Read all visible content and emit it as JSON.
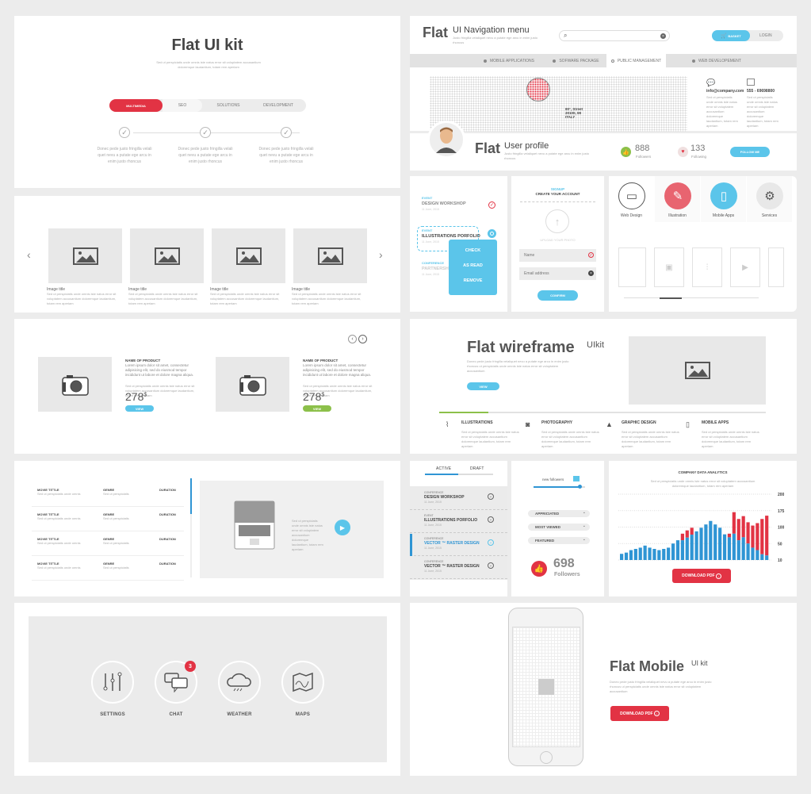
{
  "lorem": "Sed ut perspiciatis unde omnis iste natus error sit voluptatem accusantium doloremque laudantium, totam rem aperiam",
  "lorem_short": "Donec pede justo fringilla velit quet nevu a putate ege arcu in enim justo rhoncus",
  "colors": {
    "blue": "#5bc5ea",
    "red": "#e23344",
    "green": "#8cc04a",
    "gray": "#e8e8e8"
  },
  "kit": {
    "title": "Flat UI kit",
    "tabs": [
      {
        "label": "MULTIMEDIA",
        "active": true
      },
      {
        "label": "SEO"
      },
      {
        "label": "SOLUTIONS"
      },
      {
        "label": "DEVELOPMENT"
      }
    ],
    "steps": [
      "Donec pede justo fringilla velali quet nevu a putate ege arcu in enim justo rhoncus",
      "Donec pede justo fringilla velali quet nevu a putate ege arcu in enim justo rhoncus",
      "Donec pede justo fringilla velali quet nevu a putate ege arcu in enim justo rhoncus"
    ]
  },
  "gallery": {
    "items": [
      {
        "title": "Image title"
      },
      {
        "title": "Image title"
      },
      {
        "title": "Image title"
      },
      {
        "title": "Image title"
      }
    ]
  },
  "products": [
    {
      "name": "NAME OF PRODUCT",
      "desc": "Lorem ipsum dolor sit amet, consectetur adipisicing elit, sed do eiusmod tempor incididunt ut labore et dolore magna aliqua.",
      "price": "278",
      "currency": "$",
      "button": "VIEW",
      "color": "blue"
    },
    {
      "name": "NAME OF PRODUCT",
      "desc": "Lorem ipsum dolor sit amet, consectetur adipisicing elit, sed do eiusmod tempor incididunt ut labore et dolore magna aliqua.",
      "price": "278",
      "currency": "$",
      "button": "VIEW",
      "color": "green"
    }
  ],
  "movies": {
    "rows": [
      {
        "title": "MOVIE TITTLE",
        "genre": "GENRE",
        "duration": "DURATION"
      },
      {
        "title": "MOVIE TITTLE",
        "genre": "GENRE",
        "duration": "DURATION"
      },
      {
        "title": "MOVIE TITTLE",
        "genre": "GENRE",
        "duration": "DURATION"
      },
      {
        "title": "MOVIE TITTLE",
        "genre": "GENRE",
        "duration": "DURATION"
      }
    ]
  },
  "apps": [
    {
      "label": "SETTINGS",
      "icon": "sliders-icon"
    },
    {
      "label": "CHAT",
      "icon": "chat-icon",
      "badge": "3"
    },
    {
      "label": "WEATHER",
      "icon": "cloud-rain-icon"
    },
    {
      "label": "MAPS",
      "icon": "map-icon"
    }
  ],
  "nav": {
    "flat": "Flat",
    "title": "UI Navigation menu",
    "subtitle": "Justo fringilla velaliquet nevu a putate ege arcu in enim justo rhoncus",
    "basket": "BASKET",
    "login": "LOGIN",
    "menu": [
      {
        "label": "MOBILE APPLICATIONS"
      },
      {
        "label": "SOFWARE PACKAGE"
      },
      {
        "label": "PUBLIC MANAGEMENT",
        "active": true
      },
      {
        "label": "WEB DEVELOPEMENT"
      }
    ],
    "address": [
      "80°, Street",
      "20100, MI",
      "ITALY"
    ],
    "email": "info@company.com",
    "phone": "555 - 69698800"
  },
  "profile": {
    "flat": "Flat",
    "title": "User profile",
    "subtitle": "Justo fringilla velaliquet nevu a putate ege arcu in enim justo rhoncus",
    "followers": "888",
    "followers_label": "Followers",
    "following": "133",
    "following_label": "Following",
    "follow": "FOLLOW ME"
  },
  "events": [
    {
      "type": "EVENT",
      "title": "DESIGN WORKSHOP",
      "date": "11 June, 2015"
    },
    {
      "type": "EVENT",
      "title": "ILLUSTRATIONS PORFOLIO",
      "date": "11 June, 2015"
    },
    {
      "type": "CONFERENCE",
      "title": "PARTNERSHIP",
      "date": "11 June, 2015"
    }
  ],
  "context_menu": [
    "CHECK",
    "AS READ",
    "REMOVE"
  ],
  "signup": {
    "kicker": "SIGNUP",
    "title": "CREATE YOUR ACCOUNT",
    "upload": "UPLOAD YOUR PHOTO",
    "name_placeholder": "Name",
    "email_placeholder": "Email address",
    "confirm": "CONFIRM"
  },
  "services": [
    {
      "label": "Web Design",
      "icon": "browser-icon"
    },
    {
      "label": "Illustration",
      "icon": "vector-icon"
    },
    {
      "label": "Mobile Apps",
      "icon": "phone-icon"
    },
    {
      "label": "Services",
      "icon": "gears-icon"
    }
  ],
  "wireframe": {
    "title": "Flat wireframe",
    "sup": "UIkit",
    "text": "Donec pede justo fringilla velaliquet nevu a putate ege arcu in enim justo rhoncus ut perspiciatis unde omnis iste natus error sit voluptatem accusantium",
    "button": "VIEW",
    "progress": 15,
    "features": [
      {
        "label": "ILLUSTRATIONS",
        "icon": "pen-path-icon"
      },
      {
        "label": "PHOTOGRAPHY",
        "icon": "camera-icon"
      },
      {
        "label": "GRAPHIC DESIGN",
        "icon": "landscape-icon"
      },
      {
        "label": "MOBILE APPS",
        "icon": "mobile-touch-icon"
      }
    ]
  },
  "tasks": {
    "tabs": [
      "ACTIVE",
      "DRAFT"
    ],
    "items": [
      {
        "type": "CONFERENCE",
        "title": "DESIGN WORKSHOP",
        "date": "11 June, 2015"
      },
      {
        "type": "EVENT",
        "title": "ILLUSTRATIONS PORFOLIO",
        "date": "11 June, 2015"
      },
      {
        "type": "CONFERENCE",
        "title": "VECTOR ™ RASTER DESIGN",
        "date": "11 June, 2015",
        "active": true
      },
      {
        "type": "CONFERENCE",
        "title": "VECTOR ™ RASTER DESIGN",
        "date": "11 June, 2015"
      }
    ]
  },
  "stats": {
    "slider_label": "new followers",
    "slider_value": 90,
    "dropdowns": [
      "APPRICIATED",
      "MOST VIEWED",
      "FEATURED"
    ],
    "count": "698",
    "count_label": "Followers"
  },
  "chart_data": {
    "type": "bar",
    "title": "COMPANY DATA ANALYTICS",
    "subtitle": "Sed ut perspiciatis unde omnis iste natus error sit voluptatem accusantium doloremque laudantium, totam rem aperiam",
    "y_ticks": [
      10,
      50,
      100,
      175,
      200
    ],
    "ylim": [
      10,
      200
    ],
    "grid": true,
    "stacked": true,
    "series": [
      {
        "color": "#2f95d4",
        "values": [
          25,
          28,
          34,
          37,
          40,
          45,
          40,
          37,
          34,
          37,
          40,
          50,
          60,
          60,
          68,
          77,
          87,
          98,
          112,
          128,
          112,
          98,
          78,
          69,
          80,
          60,
          69,
          50,
          40,
          34,
          24,
          21
        ]
      },
      {
        "color": "#e23344",
        "stack_top": [
          null,
          null,
          null,
          null,
          null,
          null,
          null,
          null,
          null,
          null,
          null,
          null,
          null,
          80,
          90,
          98,
          null,
          null,
          null,
          null,
          null,
          null,
          null,
          80,
          168,
          137,
          150,
          122,
          107,
          118,
          137,
          152
        ]
      }
    ],
    "button": "DOWNLOAD PDF"
  },
  "mobile": {
    "title": "Flat Mobile",
    "sup": "UI kit",
    "text": "Donec pede justo fringilla velaliquet nevu a putate ege arcu in enim justo rhoncus ut perspiciatis unde omnis iste natus error sit voluptatem accusantium",
    "button": "DOWNLOAD PDF"
  }
}
